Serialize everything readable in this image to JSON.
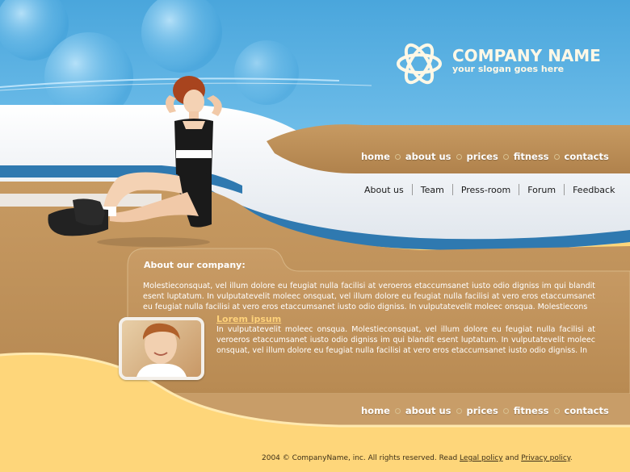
{
  "brand": {
    "name": "COMPANY NAME",
    "slogan": "your slogan goes here"
  },
  "top_nav": [
    {
      "label": "home"
    },
    {
      "label": "about us"
    },
    {
      "label": "prices"
    },
    {
      "label": "fitness"
    },
    {
      "label": "contacts"
    }
  ],
  "sub_nav": [
    {
      "label": "About us"
    },
    {
      "label": "Team"
    },
    {
      "label": "Press-room"
    },
    {
      "label": "Forum"
    },
    {
      "label": "Feedback"
    }
  ],
  "about": {
    "title": "About our company:",
    "text": "Molestieconsquat, vel illum dolore eu feugiat nulla facilisi at veroeros etaccumsanet iusto odio digniss im qui blandit esent luptatum. In vulputatevelit moleec onsquat, vel illum dolore eu feugiat nulla facilisi at vero eros etaccumsanet eu feugiat nulla facilisi at vero eros etaccumsanet iusto odio digniss. In vulputatevelit moleec onsqua. Molestiecons"
  },
  "lorem": {
    "title": "Lorem ipsum",
    "text": "In vulputatevelit moleec onsqua. Molestieconsquat, vel illum dolore eu feugiat nulla facilisi at veroeros etaccumsanet iusto odio digniss im qui blandit esent luptatum. In vulputatevelit moleec onsquat, vel illum dolore eu feugiat nulla facilisi at vero eros etaccumsanet iusto odio digniss. In"
  },
  "bottom_nav": [
    {
      "label": "home"
    },
    {
      "label": "about us"
    },
    {
      "label": "prices"
    },
    {
      "label": "fitness"
    },
    {
      "label": "contacts"
    }
  ],
  "footer": {
    "copyright": "2004 © CompanyName, inc. All rights reserved. Read ",
    "legal_link": "Legal policy",
    "and": " and ",
    "privacy_link": "Privacy policy",
    "end": "."
  },
  "colors": {
    "sky_blue": "#5aafe0",
    "tan": "#b98a52",
    "yellow": "#fed67a",
    "white_band": "#f2f4f8",
    "link_highlight": "#ffd27a"
  }
}
